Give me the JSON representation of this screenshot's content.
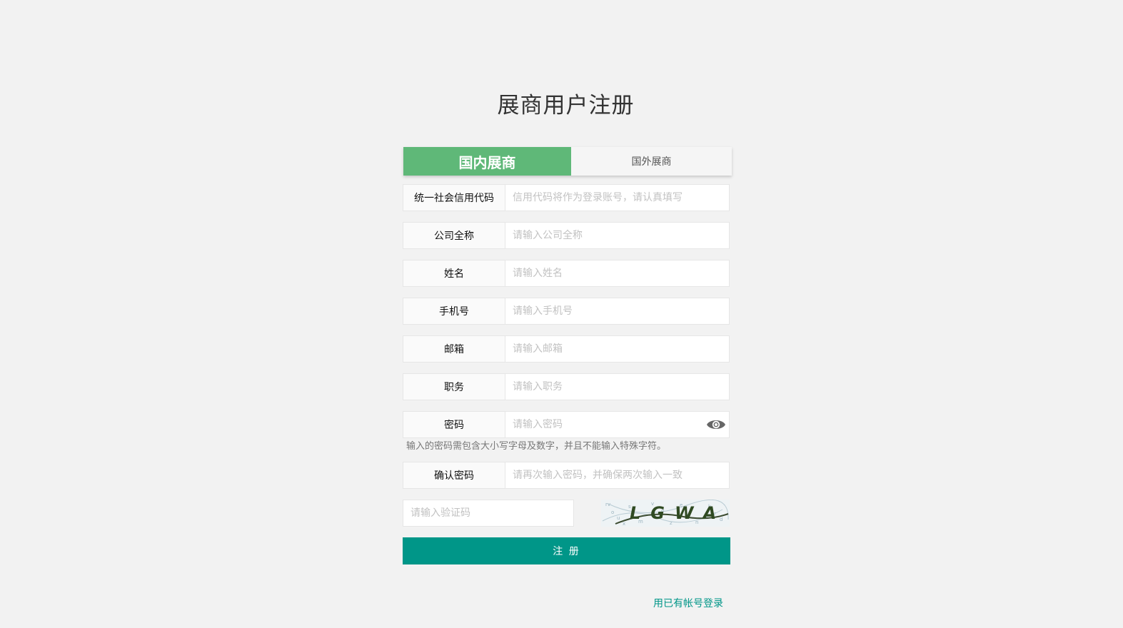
{
  "page": {
    "title": "展商用户注册"
  },
  "tabs": [
    {
      "label": "国内展商",
      "active": true
    },
    {
      "label": "国外展商",
      "active": false
    }
  ],
  "form": {
    "fields": [
      {
        "label": "统一社会信用代码",
        "placeholder": "信用代码将作为登录账号，请认真填写",
        "value": ""
      },
      {
        "label": "公司全称",
        "placeholder": "请输入公司全称",
        "value": ""
      },
      {
        "label": "姓名",
        "placeholder": "请输入姓名",
        "value": ""
      },
      {
        "label": "手机号",
        "placeholder": "请输入手机号",
        "value": ""
      },
      {
        "label": "邮箱",
        "placeholder": "请输入邮箱",
        "value": ""
      },
      {
        "label": "职务",
        "placeholder": "请输入职务",
        "value": ""
      },
      {
        "label": "密码",
        "placeholder": "请输入密码",
        "value": "",
        "icon": "eye-icon"
      },
      {
        "label": "确认密码",
        "placeholder": "请再次输入密码，并确保两次输入一致",
        "value": ""
      }
    ],
    "password_hint": "输入的密码需包含大小写字母及数字，并且不能输入特殊字符。",
    "captcha": {
      "placeholder": "请输入验证码",
      "value": "",
      "image_text": "LGWA"
    },
    "submit_label": "注 册",
    "login_link": "用已有帐号登录"
  },
  "colors": {
    "background": "#f2f2f2",
    "tab_active": "#5fb878",
    "primary": "#009688",
    "label_bg": "#fafafa",
    "border": "#e6e6e6"
  }
}
